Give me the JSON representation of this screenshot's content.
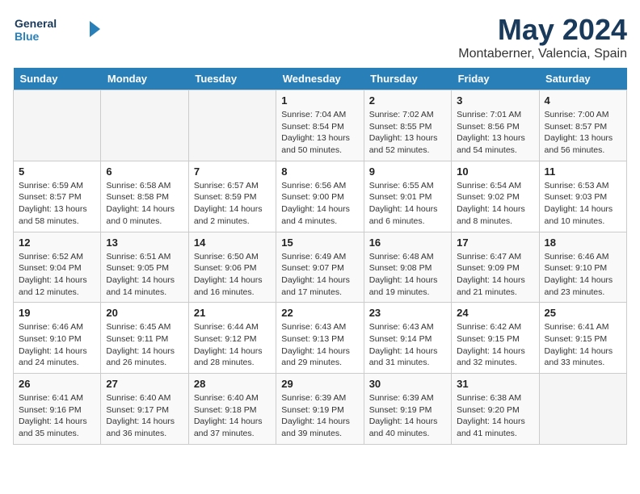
{
  "header": {
    "logo_line1": "General",
    "logo_line2": "Blue",
    "month": "May 2024",
    "location": "Montaberner, Valencia, Spain"
  },
  "weekdays": [
    "Sunday",
    "Monday",
    "Tuesday",
    "Wednesday",
    "Thursday",
    "Friday",
    "Saturday"
  ],
  "weeks": [
    [
      {
        "day": "",
        "empty": true
      },
      {
        "day": "",
        "empty": true
      },
      {
        "day": "",
        "empty": true
      },
      {
        "day": "1",
        "sunrise": "Sunrise: 7:04 AM",
        "sunset": "Sunset: 8:54 PM",
        "daylight": "Daylight: 13 hours and 50 minutes."
      },
      {
        "day": "2",
        "sunrise": "Sunrise: 7:02 AM",
        "sunset": "Sunset: 8:55 PM",
        "daylight": "Daylight: 13 hours and 52 minutes."
      },
      {
        "day": "3",
        "sunrise": "Sunrise: 7:01 AM",
        "sunset": "Sunset: 8:56 PM",
        "daylight": "Daylight: 13 hours and 54 minutes."
      },
      {
        "day": "4",
        "sunrise": "Sunrise: 7:00 AM",
        "sunset": "Sunset: 8:57 PM",
        "daylight": "Daylight: 13 hours and 56 minutes."
      }
    ],
    [
      {
        "day": "5",
        "sunrise": "Sunrise: 6:59 AM",
        "sunset": "Sunset: 8:57 PM",
        "daylight": "Daylight: 13 hours and 58 minutes."
      },
      {
        "day": "6",
        "sunrise": "Sunrise: 6:58 AM",
        "sunset": "Sunset: 8:58 PM",
        "daylight": "Daylight: 14 hours and 0 minutes."
      },
      {
        "day": "7",
        "sunrise": "Sunrise: 6:57 AM",
        "sunset": "Sunset: 8:59 PM",
        "daylight": "Daylight: 14 hours and 2 minutes."
      },
      {
        "day": "8",
        "sunrise": "Sunrise: 6:56 AM",
        "sunset": "Sunset: 9:00 PM",
        "daylight": "Daylight: 14 hours and 4 minutes."
      },
      {
        "day": "9",
        "sunrise": "Sunrise: 6:55 AM",
        "sunset": "Sunset: 9:01 PM",
        "daylight": "Daylight: 14 hours and 6 minutes."
      },
      {
        "day": "10",
        "sunrise": "Sunrise: 6:54 AM",
        "sunset": "Sunset: 9:02 PM",
        "daylight": "Daylight: 14 hours and 8 minutes."
      },
      {
        "day": "11",
        "sunrise": "Sunrise: 6:53 AM",
        "sunset": "Sunset: 9:03 PM",
        "daylight": "Daylight: 14 hours and 10 minutes."
      }
    ],
    [
      {
        "day": "12",
        "sunrise": "Sunrise: 6:52 AM",
        "sunset": "Sunset: 9:04 PM",
        "daylight": "Daylight: 14 hours and 12 minutes."
      },
      {
        "day": "13",
        "sunrise": "Sunrise: 6:51 AM",
        "sunset": "Sunset: 9:05 PM",
        "daylight": "Daylight: 14 hours and 14 minutes."
      },
      {
        "day": "14",
        "sunrise": "Sunrise: 6:50 AM",
        "sunset": "Sunset: 9:06 PM",
        "daylight": "Daylight: 14 hours and 16 minutes."
      },
      {
        "day": "15",
        "sunrise": "Sunrise: 6:49 AM",
        "sunset": "Sunset: 9:07 PM",
        "daylight": "Daylight: 14 hours and 17 minutes."
      },
      {
        "day": "16",
        "sunrise": "Sunrise: 6:48 AM",
        "sunset": "Sunset: 9:08 PM",
        "daylight": "Daylight: 14 hours and 19 minutes."
      },
      {
        "day": "17",
        "sunrise": "Sunrise: 6:47 AM",
        "sunset": "Sunset: 9:09 PM",
        "daylight": "Daylight: 14 hours and 21 minutes."
      },
      {
        "day": "18",
        "sunrise": "Sunrise: 6:46 AM",
        "sunset": "Sunset: 9:10 PM",
        "daylight": "Daylight: 14 hours and 23 minutes."
      }
    ],
    [
      {
        "day": "19",
        "sunrise": "Sunrise: 6:46 AM",
        "sunset": "Sunset: 9:10 PM",
        "daylight": "Daylight: 14 hours and 24 minutes."
      },
      {
        "day": "20",
        "sunrise": "Sunrise: 6:45 AM",
        "sunset": "Sunset: 9:11 PM",
        "daylight": "Daylight: 14 hours and 26 minutes."
      },
      {
        "day": "21",
        "sunrise": "Sunrise: 6:44 AM",
        "sunset": "Sunset: 9:12 PM",
        "daylight": "Daylight: 14 hours and 28 minutes."
      },
      {
        "day": "22",
        "sunrise": "Sunrise: 6:43 AM",
        "sunset": "Sunset: 9:13 PM",
        "daylight": "Daylight: 14 hours and 29 minutes."
      },
      {
        "day": "23",
        "sunrise": "Sunrise: 6:43 AM",
        "sunset": "Sunset: 9:14 PM",
        "daylight": "Daylight: 14 hours and 31 minutes."
      },
      {
        "day": "24",
        "sunrise": "Sunrise: 6:42 AM",
        "sunset": "Sunset: 9:15 PM",
        "daylight": "Daylight: 14 hours and 32 minutes."
      },
      {
        "day": "25",
        "sunrise": "Sunrise: 6:41 AM",
        "sunset": "Sunset: 9:15 PM",
        "daylight": "Daylight: 14 hours and 33 minutes."
      }
    ],
    [
      {
        "day": "26",
        "sunrise": "Sunrise: 6:41 AM",
        "sunset": "Sunset: 9:16 PM",
        "daylight": "Daylight: 14 hours and 35 minutes."
      },
      {
        "day": "27",
        "sunrise": "Sunrise: 6:40 AM",
        "sunset": "Sunset: 9:17 PM",
        "daylight": "Daylight: 14 hours and 36 minutes."
      },
      {
        "day": "28",
        "sunrise": "Sunrise: 6:40 AM",
        "sunset": "Sunset: 9:18 PM",
        "daylight": "Daylight: 14 hours and 37 minutes."
      },
      {
        "day": "29",
        "sunrise": "Sunrise: 6:39 AM",
        "sunset": "Sunset: 9:19 PM",
        "daylight": "Daylight: 14 hours and 39 minutes."
      },
      {
        "day": "30",
        "sunrise": "Sunrise: 6:39 AM",
        "sunset": "Sunset: 9:19 PM",
        "daylight": "Daylight: 14 hours and 40 minutes."
      },
      {
        "day": "31",
        "sunrise": "Sunrise: 6:38 AM",
        "sunset": "Sunset: 9:20 PM",
        "daylight": "Daylight: 14 hours and 41 minutes."
      },
      {
        "day": "",
        "empty": true
      }
    ]
  ]
}
